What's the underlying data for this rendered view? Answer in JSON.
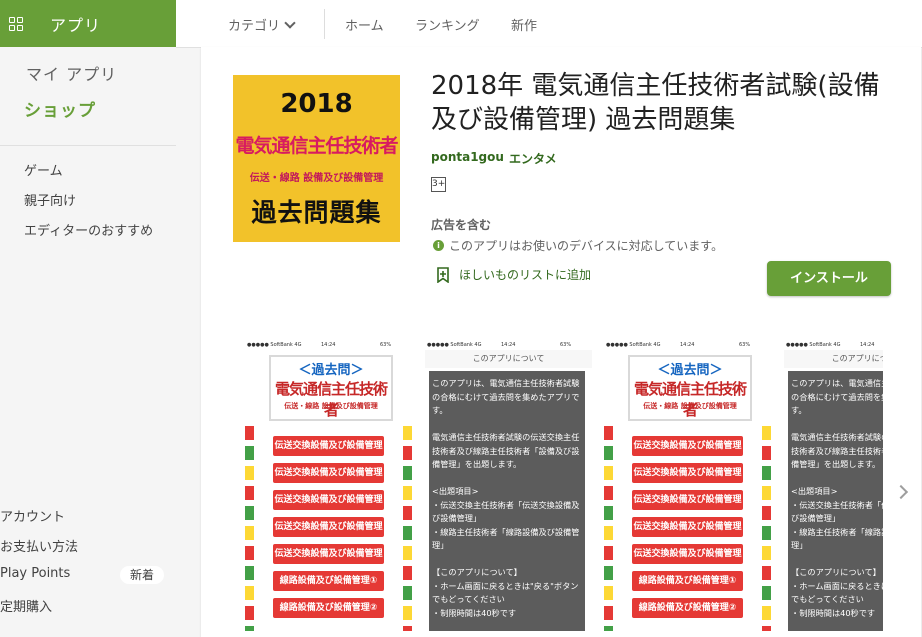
{
  "brand": {
    "icon": "apps-grid-icon",
    "label": "アプリ",
    "color": "#689f38"
  },
  "topnav": {
    "categories": "カテゴリ",
    "home": "ホーム",
    "ranking": "ランキング",
    "new": "新作"
  },
  "sidebar": {
    "my_apps": "マイ アプリ",
    "shop": "ショップ",
    "items": [
      "ゲーム",
      "親子向け",
      "エディターのおすすめ"
    ],
    "account_items": [
      "アカウント",
      "お支払い方法",
      "Play Points",
      "定期購入"
    ],
    "play_points_badge": "新着"
  },
  "app": {
    "icon_lines": [
      "2018",
      "電気通信主任技術者",
      "伝送・線路 設備及び設備管理",
      "過去問題集"
    ],
    "title": "2018年 電気通信主任技術者試験(設備及び設備管理) 過去問題集",
    "developer": "ponta1gou",
    "genre": "エンタメ",
    "rating": "3+",
    "contains_ads": "広告を含む",
    "compat_icon": "info-icon",
    "compat": "このアプリはお使いのデバイスに対応しています。",
    "wishlist_icon": "bookmark-add-icon",
    "wishlist": "ほしいものリストに追加",
    "install": "インストール"
  },
  "screenshots": {
    "status": {
      "carrier": "●●●●● SoftBank 4G",
      "time": "14:24",
      "battery": "63%"
    },
    "menu": {
      "header_top": "＜過去問＞",
      "header_main": "電気通信主任技術者",
      "header_sub": "伝送・線路 設備及び設備管理",
      "buttons": [
        "伝送交換設備及び設備管理①",
        "伝送交換設備及び設備管理②",
        "伝送交換設備及び設備管理③",
        "伝送交換設備及び設備管理④",
        "伝送交換設備及び設備管理⑤",
        "線路設備及び設備管理①",
        "線路設備及び設備管理②"
      ]
    },
    "info": {
      "title": "このアプリについて",
      "text": "このアプリは、電気通信主任技術者試験の合格にむけて過去問を集めたアプリです。\n\n電気通信主任技術者試験の伝送交換主任技術者及び線路主任技術者「設備及び設備管理」を出題します。\n\n<出題項目>\n・伝送交換主任技術者「伝送交換設備及び設備管理」\n・線路主任技術者「線路設備及び設備管理」\n\n【このアプリについて】\n・ホーム画面に戻るときは\"戻る\"ボタンでもどってください\n・制限時間は40秒です"
    },
    "next_icon": "chevron-right-icon"
  }
}
